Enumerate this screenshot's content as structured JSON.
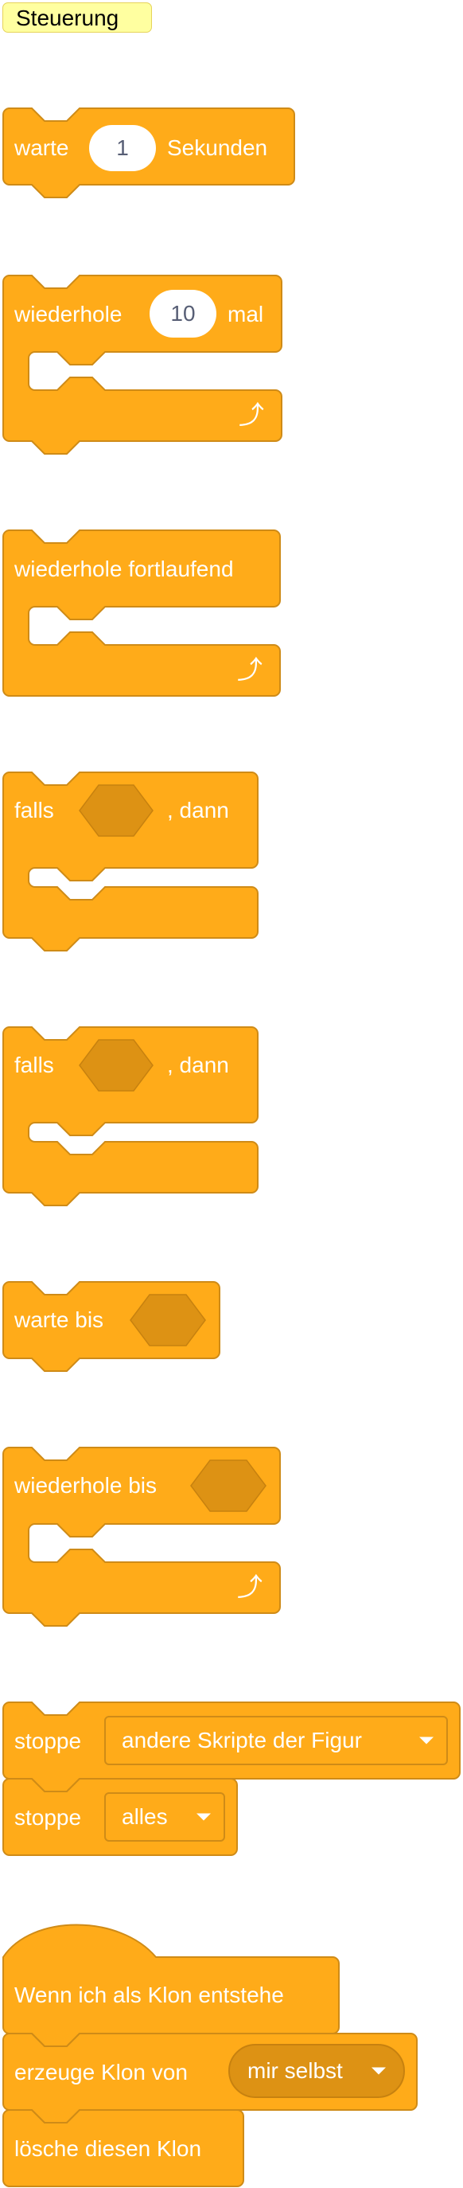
{
  "category": {
    "title": "Steuerung"
  },
  "colors": {
    "block_fill": "#ffab19",
    "block_stroke": "#cf8b17",
    "hex_slot": "#dd9214",
    "category_bg": "#ffffa0"
  },
  "icons": {
    "loop": "loop-arrow-icon",
    "dropdown": "dropdown-arrow-icon"
  },
  "blocks": {
    "wait": {
      "label": "warte",
      "value": "1",
      "suffix": "Sekunden"
    },
    "repeat": {
      "label": "wiederhole",
      "value": "10",
      "suffix": "mal"
    },
    "forever": {
      "label": "wiederhole fortlaufend"
    },
    "if_then_1": {
      "label": "falls",
      "suffix": ", dann"
    },
    "if_then_2": {
      "label": "falls",
      "suffix": ", dann"
    },
    "wait_until": {
      "label": "warte bis"
    },
    "repeat_until": {
      "label": "wiederhole bis"
    },
    "stop_other": {
      "label": "stoppe",
      "option": "andere Skripte der Figur"
    },
    "stop_all": {
      "label": "stoppe",
      "option": "alles"
    },
    "clone_hat": {
      "label": "Wenn ich als Klon entstehe"
    },
    "create_clone": {
      "label": "erzeuge Klon von",
      "option": "mir selbst"
    },
    "delete_clone": {
      "label": "lösche diesen Klon"
    }
  }
}
